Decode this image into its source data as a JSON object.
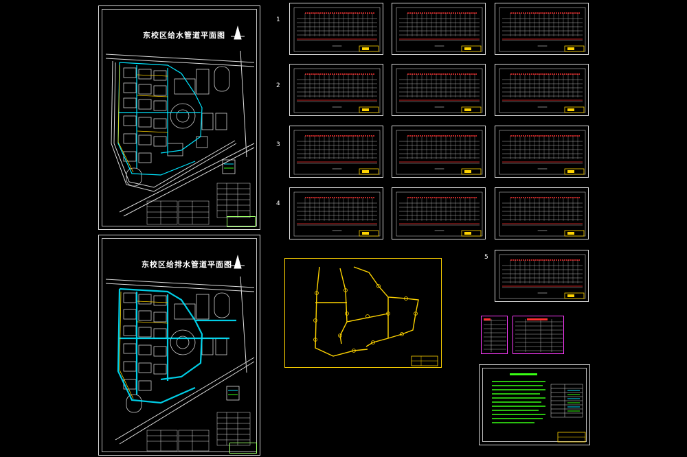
{
  "plans": [
    {
      "title": "东校区给水管道平面图"
    },
    {
      "title": "东校区给排水管道平面图"
    }
  ],
  "row_numbers": [
    "1",
    "2",
    "3",
    "4",
    "5"
  ],
  "colors": {
    "background": "#000000",
    "sheet_border": "#dcdcdc",
    "water_pipe": "#00e5ff",
    "highlight": "#ffd400",
    "notes_text": "#39ff14",
    "table_red": "#ff3030",
    "legend_magenta": "#ff3cff"
  }
}
